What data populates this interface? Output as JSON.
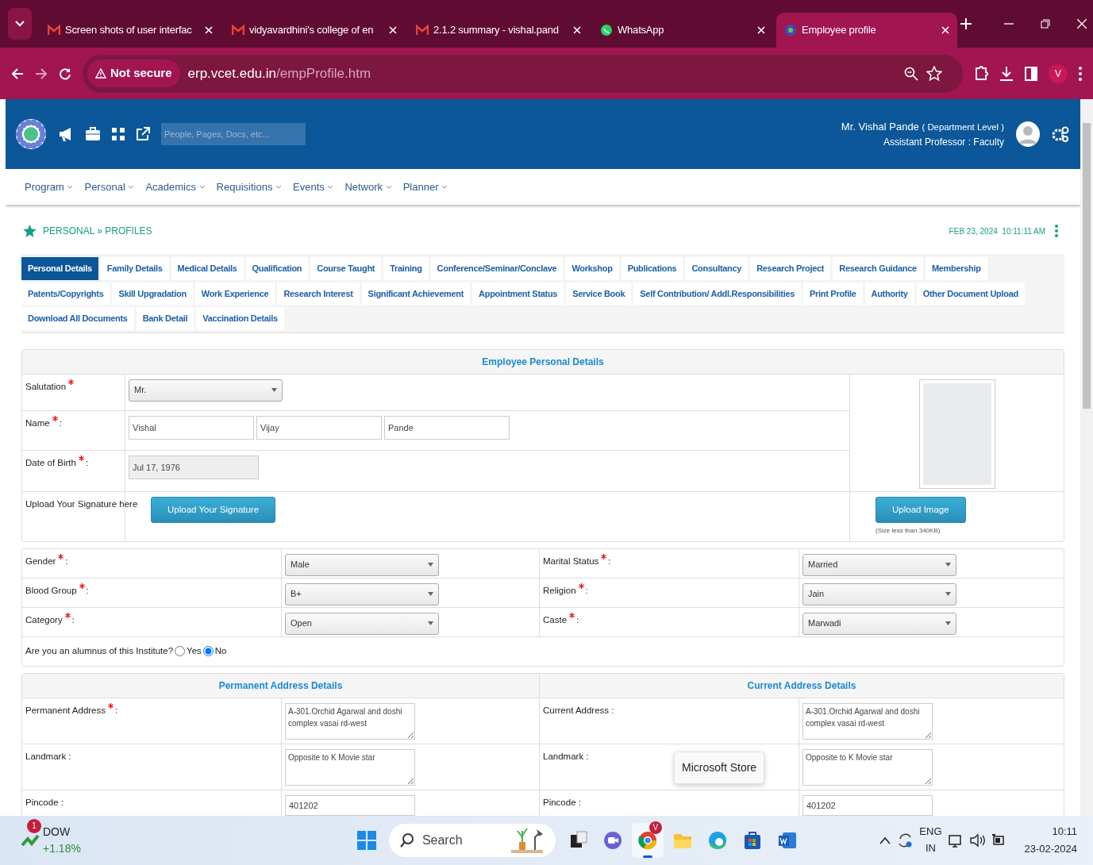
{
  "browser": {
    "tabs": [
      {
        "title": "Screen shots of user interfac",
        "kind": "mail",
        "selected": false
      },
      {
        "title": "vidyavardhini's college of en",
        "kind": "mail",
        "selected": false
      },
      {
        "title": "2.1.2 summary - vishal.pand",
        "kind": "mail",
        "selected": false
      },
      {
        "title": "WhatsApp",
        "kind": "chat",
        "selected": false
      },
      {
        "title": "Employee profile",
        "kind": "globe",
        "selected": true
      }
    ],
    "security_label": "Not secure",
    "url_host": "erp.vcet.edu.in",
    "url_path": "/empProfile.htm",
    "profile_initial": "V"
  },
  "header": {
    "search_placeholder": "People, Pages, Docs, etc...",
    "user_name": "Mr. Vishal Pande",
    "user_level": "( Department Level )",
    "user_role": "Assistant Professor : Faculty"
  },
  "menu": [
    "Program",
    "Personal",
    "Academics",
    "Requisitions",
    "Events",
    "Network",
    "Planner"
  ],
  "breadcrumb": {
    "section": "PERSONAL",
    "separator": "»",
    "page": "PROFILES"
  },
  "datetime": "FEB 23, 2024  10:11:11 AM",
  "tab_rows": [
    [
      {
        "label": "Personal Details",
        "selected": true
      },
      {
        "label": "Family Details",
        "selected": false
      },
      {
        "label": "Medical Details",
        "selected": false
      },
      {
        "label": "Qualification",
        "selected": false
      },
      {
        "label": "Course Taught",
        "selected": false
      },
      {
        "label": "Training",
        "selected": false
      },
      {
        "label": "Conference/Seminar/Conclave",
        "selected": false
      },
      {
        "label": "Workshop",
        "selected": false
      },
      {
        "label": "Publications",
        "selected": false
      },
      {
        "label": "Consultancy",
        "selected": false
      },
      {
        "label": "Research Project",
        "selected": false
      },
      {
        "label": "Research Guidance",
        "selected": false
      },
      {
        "label": "Membership",
        "selected": false
      }
    ],
    [
      {
        "label": "Patents/Copyrights",
        "selected": false
      },
      {
        "label": "Skill Upgradation",
        "selected": false
      },
      {
        "label": "Work Experience",
        "selected": false
      },
      {
        "label": "Research Interest",
        "selected": false
      },
      {
        "label": "Significant Achievement",
        "selected": false
      },
      {
        "label": "Appointment Status",
        "selected": false
      },
      {
        "label": "Service Book",
        "selected": false
      },
      {
        "label": "Self Contribution/ Addl.Responsibilities",
        "selected": false
      },
      {
        "label": "Print Profile",
        "selected": false
      },
      {
        "label": "Authority",
        "selected": false
      },
      {
        "label": "Other Document Upload",
        "selected": false
      }
    ],
    [
      {
        "label": "Download All Documents",
        "selected": false
      },
      {
        "label": "Bank Detail",
        "selected": false
      },
      {
        "label": "Vaccination Details",
        "selected": false
      }
    ]
  ],
  "personal": {
    "title": "Employee Personal Details",
    "salutation": {
      "label": "Salutation",
      "required": true,
      "value": "Mr."
    },
    "name": {
      "label": "Name",
      "required": true,
      "after": ":",
      "first": "Vishal",
      "middle": "Vijay",
      "last": "Pande"
    },
    "dob": {
      "label": "Date of Birth",
      "required": true,
      "after": ":",
      "value": "Jul 17, 1976"
    },
    "signature": {
      "label": "Upload Your Signature here",
      "button": "Upload Your Signature"
    },
    "photo": {
      "button": "Upload Image",
      "note": "(Size less than 340KB)"
    }
  },
  "details": {
    "rows": [
      [
        {
          "label": "Gender",
          "required": true,
          "after": ":",
          "value": "Male"
        },
        {
          "label": "Marital Status",
          "required": true,
          "after": ":",
          "value": "Married"
        }
      ],
      [
        {
          "label": "Blood Group",
          "required": true,
          "after": ":",
          "value": "B+"
        },
        {
          "label": "Religion",
          "required": true,
          "after": ":",
          "value": "Jain"
        }
      ],
      [
        {
          "label": "Category",
          "required": true,
          "after": ":",
          "value": "Open"
        },
        {
          "label": "Caste",
          "required": true,
          "after": ":",
          "value": "Marwadi"
        }
      ]
    ],
    "alumnus": {
      "question": "Are you an alumnus of this Institute?",
      "options": [
        {
          "label": "Yes",
          "selected": false
        },
        {
          "label": "No",
          "selected": true
        }
      ]
    }
  },
  "addresses": [
    {
      "title": "Permanent Address Details",
      "rows": [
        {
          "kind": "textarea",
          "label": "Permanent Address",
          "required": true,
          "after": ":",
          "value": "A-301.Orchid Agarwal and doshi complex vasai rd-west"
        },
        {
          "kind": "textarea",
          "label": "Landmark",
          "required": false,
          "after": " :",
          "value": "Opposite to K Movie star"
        },
        {
          "kind": "input",
          "label": "Pincode",
          "required": false,
          "after": " :",
          "value": "401202"
        }
      ]
    },
    {
      "title": "Current Address Details",
      "rows": [
        {
          "kind": "textarea",
          "label": "Current Address",
          "required": false,
          "after": " :",
          "value": "A-301.Orchid Agarwal and doshi complex vasai rd-west"
        },
        {
          "kind": "textarea",
          "label": "Landmark",
          "required": false,
          "after": " :",
          "value": "Opposite to K Movie star"
        },
        {
          "kind": "input",
          "label": "Pincode",
          "required": false,
          "after": " :",
          "value": "401202"
        }
      ]
    }
  ],
  "tooltip": "Microsoft Store",
  "taskbar": {
    "widget": {
      "badge": "1",
      "name": "DOW",
      "change": "+1.18%"
    },
    "search": "Search",
    "apps": [
      {
        "kind": "task",
        "active": false
      },
      {
        "kind": "meet",
        "active": false
      },
      {
        "kind": "browser",
        "active": true,
        "badge": "V"
      },
      {
        "kind": "folder",
        "active": false
      },
      {
        "kind": "edge",
        "active": false
      },
      {
        "kind": "store",
        "active": false
      },
      {
        "kind": "word",
        "active": false
      }
    ],
    "lang": "ENG",
    "region": "IN",
    "time": "10:11",
    "date": "23-02-2024"
  }
}
